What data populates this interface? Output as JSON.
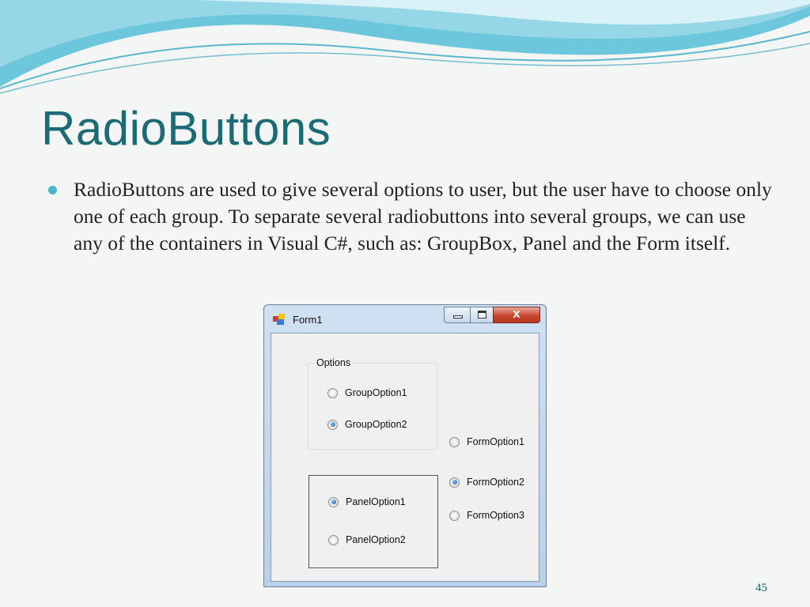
{
  "slide": {
    "title": "RadioButtons",
    "bullet": "RadioButtons are used to give several options to user, but the user have to choose only one of each group. To separate several radiobuttons into several groups, we can use any of the containers in Visual C#, such as: GroupBox, Panel and the Form itself.",
    "page_number": "45",
    "colors": {
      "title": "#1b6a76",
      "bullet": "#47b8c8",
      "wave": "#4fb8cf"
    }
  },
  "window": {
    "title": "Form1",
    "icon": "form-app-icon",
    "controls": {
      "minimize_icon": "minimize-icon",
      "maximize_icon": "maximize-icon",
      "close_symbol": "x"
    },
    "groupbox": {
      "caption": "Options",
      "options": [
        {
          "label": "GroupOption1",
          "checked": false
        },
        {
          "label": "GroupOption2",
          "checked": true
        }
      ]
    },
    "panel": {
      "options": [
        {
          "label": "PanelOption1",
          "checked": true
        },
        {
          "label": "PanelOption2",
          "checked": false
        }
      ]
    },
    "form_options": [
      {
        "label": "FormOption1",
        "checked": false
      },
      {
        "label": "FormOption2",
        "checked": true
      },
      {
        "label": "FormOption3",
        "checked": false
      }
    ]
  }
}
